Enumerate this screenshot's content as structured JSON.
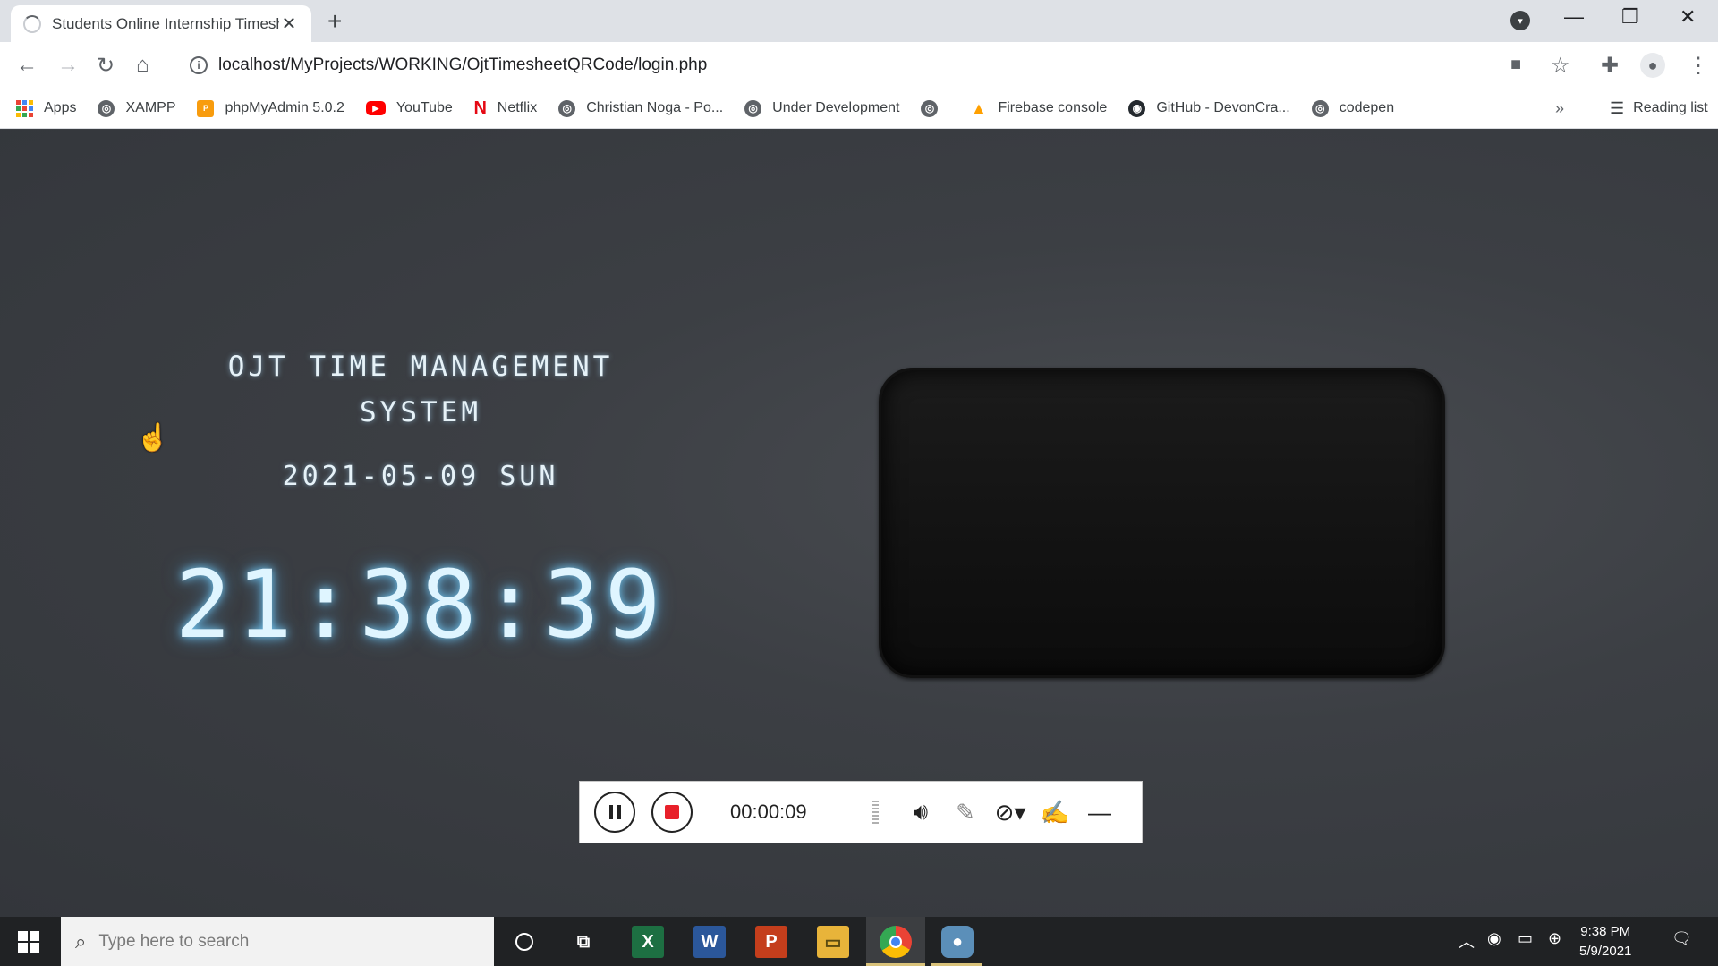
{
  "browser": {
    "tab_title": "Students Online Internship Timesheet",
    "tab_close": "✕",
    "new_tab": "+",
    "url": "localhost/MyProjects/WORKING/OjtTimesheetQRCode/login.php",
    "bookmarks": [
      {
        "label": "Apps",
        "icon": "apps-grid-icon"
      },
      {
        "label": "XAMPP",
        "icon": "globe-icon"
      },
      {
        "label": "phpMyAdmin 5.0.2",
        "icon": "pma-icon"
      },
      {
        "label": "YouTube",
        "icon": "youtube-icon"
      },
      {
        "label": "Netflix",
        "icon": "netflix-icon"
      },
      {
        "label": "Christian Noga - Po...",
        "icon": "globe-icon"
      },
      {
        "label": "Under Development",
        "icon": "globe-icon"
      },
      {
        "label": "",
        "icon": "globe-icon"
      },
      {
        "label": "Firebase console",
        "icon": "firebase-icon"
      },
      {
        "label": "GitHub - DevonCra...",
        "icon": "github-icon"
      },
      {
        "label": "codepen",
        "icon": "globe-icon"
      }
    ],
    "more": "»",
    "reading_list": "Reading list"
  },
  "page": {
    "title": "OJT TIME MANAGEMENT SYSTEM",
    "date": "2021-05-09 SUN",
    "time": "21:38:39"
  },
  "recorder": {
    "elapsed": "00:00:09"
  },
  "taskbar": {
    "search_placeholder": "Type here to search",
    "time": "9:38 PM",
    "date": "5/9/2021"
  },
  "colors": {
    "page_bg": "#3c3f44",
    "clock_glow": "#78d2ff",
    "stop_red": "#e8202a",
    "youtube": "#ff0000",
    "netflix": "#e50914",
    "firebase": "#ffca28"
  }
}
